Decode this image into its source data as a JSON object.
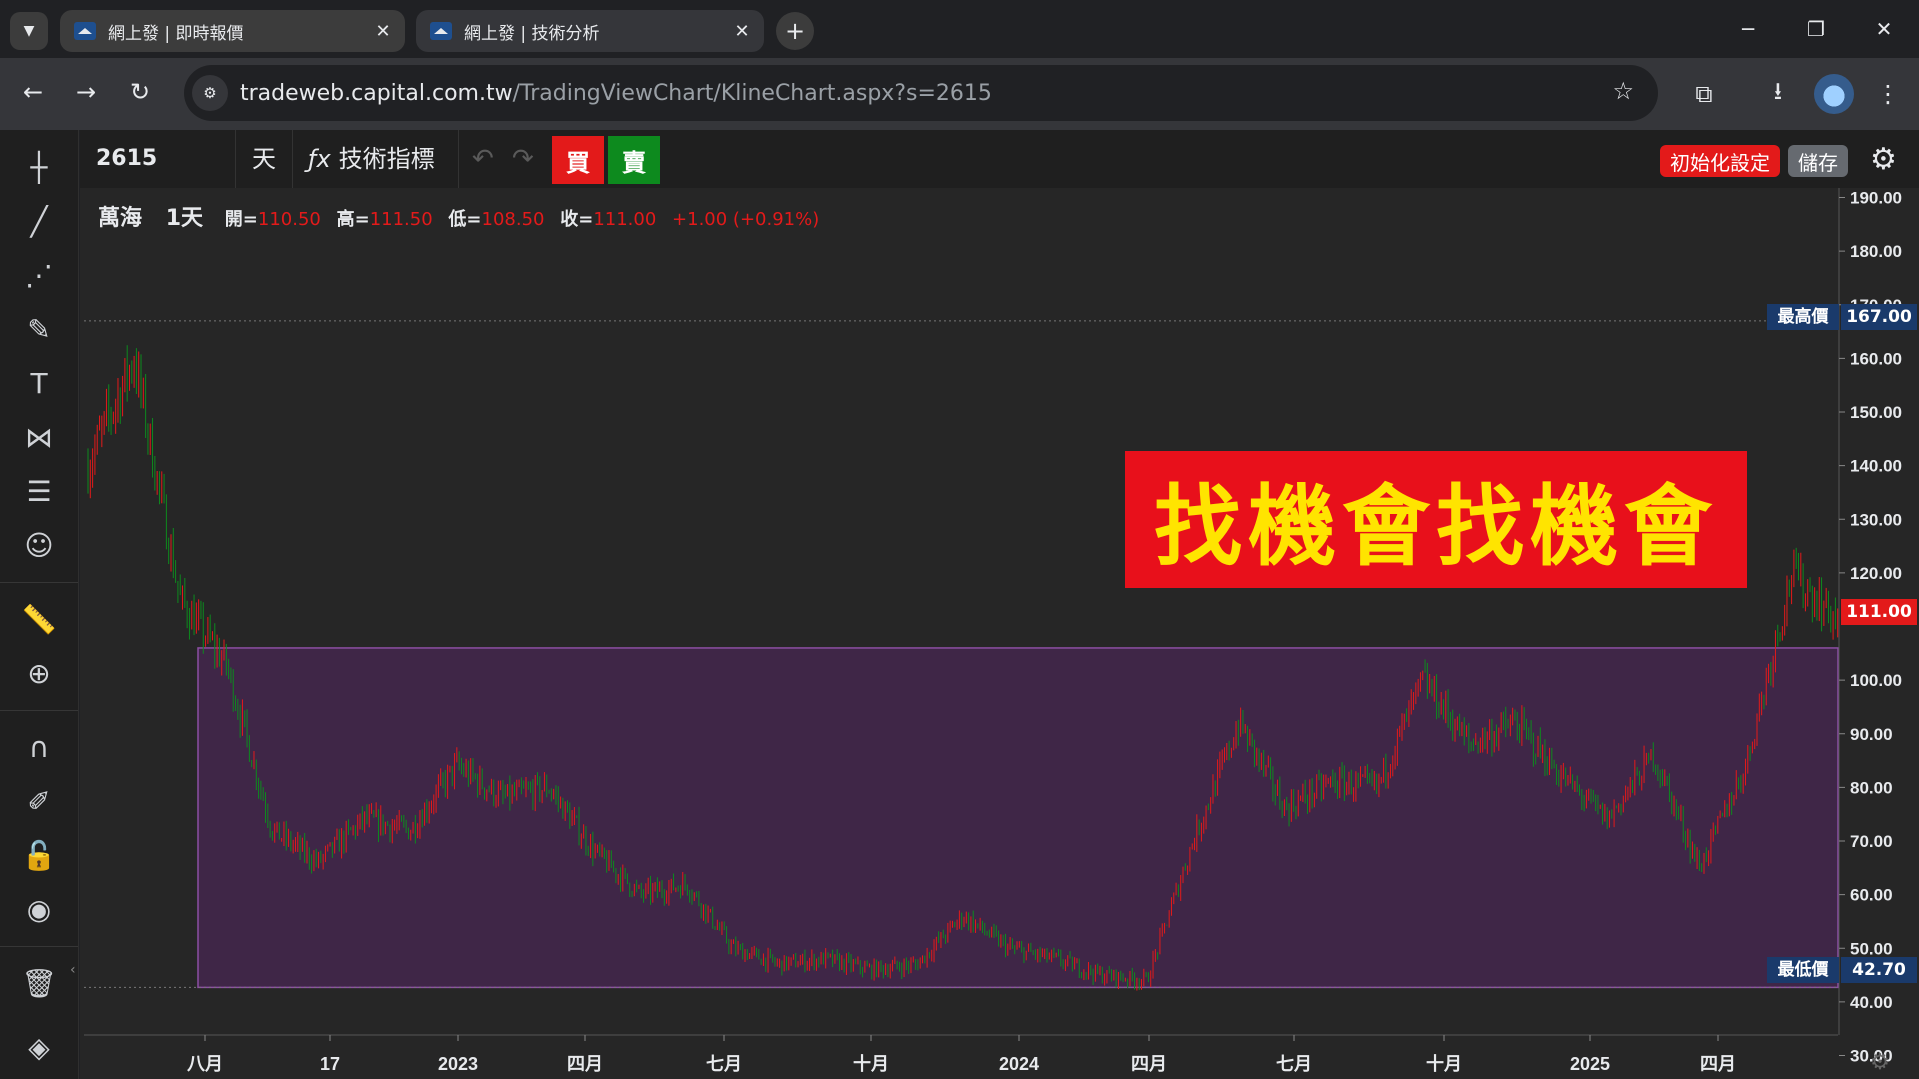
{
  "browser": {
    "tabs": [
      {
        "title": "網上發 | 即時報價",
        "active": false
      },
      {
        "title": "網上發 | 技術分析",
        "active": true
      }
    ],
    "url_host": "tradeweb.capital.com.tw",
    "url_path": "/TradingViewChart/KlineChart.aspx?s=2615"
  },
  "toolbar": {
    "symbol": "2615",
    "interval": "天",
    "indicators_label": "技術指標",
    "buy_label": "買",
    "sell_label": "賣",
    "reset_label": "初始化設定",
    "save_label": "儲存"
  },
  "legend": {
    "name": "萬海",
    "interval": "1天",
    "open_label": "開=",
    "open": "110.50",
    "high_label": "高=",
    "high": "111.50",
    "low_label": "低=",
    "low": "108.50",
    "close_label": "收=",
    "close": "111.00",
    "change": "+1.00 (+0.91%)"
  },
  "banner_text": "找機會找機會",
  "colors": {
    "up": "#e31a1a",
    "down": "#0d8a1e",
    "range_fill": "#3f2647",
    "range_border": "#8c4fa3"
  },
  "chart_data": {
    "type": "candlestick",
    "y_axis_ticks": [
      "190.00",
      "180.00",
      "170.00",
      "160.00",
      "150.00",
      "140.00",
      "130.00",
      "120.00",
      "100.00",
      "90.00",
      "80.00",
      "70.00",
      "60.00",
      "50.00",
      "40.00",
      "30.00"
    ],
    "ylim": [
      30,
      190
    ],
    "x_axis_ticks": [
      "八月",
      "17",
      "2023",
      "四月",
      "七月",
      "十月",
      "2024",
      "四月",
      "七月",
      "十月",
      "2025",
      "四月"
    ],
    "highest_label": "最高價",
    "highest": 167.0,
    "lowest_label": "最低價",
    "lowest": 42.7,
    "last_price": "111.00",
    "range_box": {
      "top": 106,
      "bottom": 42.7
    },
    "price_path": [
      {
        "t": "2022-05",
        "p": 140
      },
      {
        "t": "2022-06",
        "p": 160
      },
      {
        "t": "2022-07",
        "p": 115
      },
      {
        "t": "2022-08",
        "p": 103
      },
      {
        "t": "2022-09",
        "p": 72
      },
      {
        "t": "2022-10",
        "p": 66
      },
      {
        "t": "2022-11",
        "p": 74
      },
      {
        "t": "2022-12",
        "p": 72
      },
      {
        "t": "2023-01",
        "p": 84
      },
      {
        "t": "2023-02",
        "p": 78
      },
      {
        "t": "2023-03",
        "p": 80
      },
      {
        "t": "2023-04",
        "p": 68
      },
      {
        "t": "2023-05",
        "p": 60
      },
      {
        "t": "2023-06",
        "p": 62
      },
      {
        "t": "2023-07",
        "p": 50
      },
      {
        "t": "2023-08",
        "p": 47
      },
      {
        "t": "2023-09",
        "p": 48
      },
      {
        "t": "2023-10",
        "p": 46
      },
      {
        "t": "2023-11",
        "p": 47
      },
      {
        "t": "2023-12",
        "p": 56
      },
      {
        "t": "2024-01",
        "p": 50
      },
      {
        "t": "2024-02",
        "p": 48
      },
      {
        "t": "2024-03",
        "p": 45
      },
      {
        "t": "2024-04",
        "p": 44
      },
      {
        "t": "2024-05",
        "p": 70
      },
      {
        "t": "2024-06",
        "p": 92
      },
      {
        "t": "2024-07",
        "p": 76
      },
      {
        "t": "2024-08",
        "p": 81
      },
      {
        "t": "2024-09",
        "p": 80
      },
      {
        "t": "2024-10",
        "p": 100
      },
      {
        "t": "2024-11",
        "p": 88
      },
      {
        "t": "2024-12",
        "p": 92
      },
      {
        "t": "2025-01",
        "p": 82
      },
      {
        "t": "2025-02",
        "p": 74
      },
      {
        "t": "2025-03",
        "p": 86
      },
      {
        "t": "2025-04",
        "p": 65
      },
      {
        "t": "2025-05",
        "p": 84
      },
      {
        "t": "2025-06",
        "p": 120
      },
      {
        "t": "2025-07",
        "p": 111
      }
    ]
  }
}
